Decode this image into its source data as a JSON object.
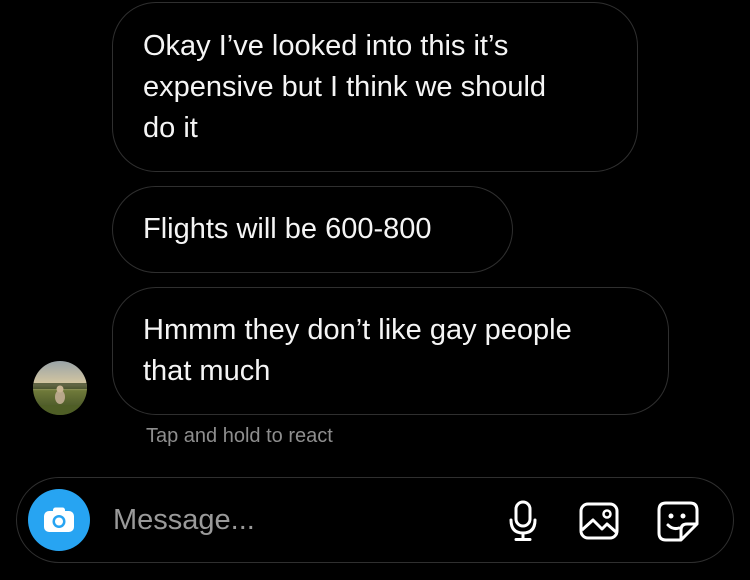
{
  "messages": [
    {
      "lines": [
        "Okay I’ve looked into this it’s",
        "expensive but I think we should",
        "do it"
      ]
    },
    {
      "lines": [
        "Flights will be 600-800"
      ]
    },
    {
      "lines": [
        "Hmmm they don’t like gay people",
        "that much"
      ]
    }
  ],
  "react_hint": "Tap and hold to react",
  "composer": {
    "placeholder": "Message..."
  },
  "icons": {
    "camera": "camera-icon",
    "mic": "microphone-icon",
    "gallery": "image-gallery-icon",
    "sticker": "sticker-icon"
  },
  "colors": {
    "background": "#000000",
    "bubble_border": "#2f2f2f",
    "camera_button": "#27a4f2",
    "hint_text": "#8e8e8e"
  }
}
